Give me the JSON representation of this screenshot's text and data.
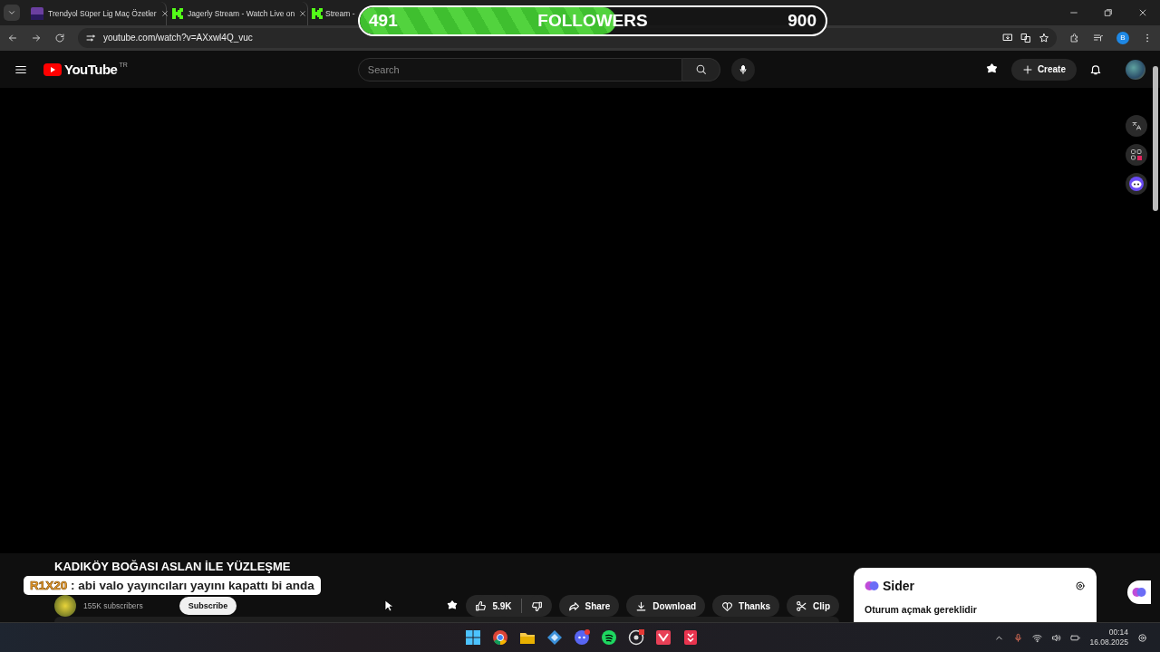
{
  "browser": {
    "tabs": [
      {
        "title": "Trendyol Süper Lig Maç Özetler",
        "kind": "trendyol",
        "selected": false
      },
      {
        "title": "Jagerly Stream - Watch Live on",
        "kind": "kick",
        "selected": false
      },
      {
        "title": "Stream -",
        "kind": "kick",
        "selected": false
      }
    ],
    "url": "youtube.com/watch?v=AXxwl4Q_vuc",
    "profile": "B"
  },
  "youtube": {
    "logo": "YouTube",
    "region": "TR",
    "search_placeholder": "Search",
    "create": "Create"
  },
  "video": {
    "title": "KADIKÖY BOĞASI ASLAN İLE YÜZLEŞME",
    "subscribers": "155K subscribers",
    "subscribe": "Subscribe",
    "actions": [
      {
        "kind": "like",
        "label": "5.9K"
      },
      {
        "kind": "share",
        "label": "Share"
      },
      {
        "kind": "download",
        "label": "Download"
      },
      {
        "kind": "thanks",
        "label": "Thanks"
      },
      {
        "kind": "clip",
        "label": "Clip"
      }
    ]
  },
  "sider": {
    "title": "Sider",
    "message": "Oturum açmak gereklidir"
  },
  "overlay": {
    "followers": {
      "current": "491",
      "label": "FOLLOWERS",
      "goal": "900",
      "level": 0.55
    },
    "chat": {
      "user": "R1X20",
      "message": ": abi valo yayıncıları yayını kapattı bi anda"
    }
  },
  "taskbar": {
    "apps": [
      {
        "kind": "start"
      },
      {
        "kind": "chrome"
      },
      {
        "kind": "folder"
      },
      {
        "kind": "tool"
      },
      {
        "kind": "discord"
      },
      {
        "kind": "spotify"
      },
      {
        "kind": "obs"
      },
      {
        "kind": "valorant"
      },
      {
        "kind": "downloader"
      }
    ],
    "time": "00:14",
    "date": "16.08.2025"
  }
}
